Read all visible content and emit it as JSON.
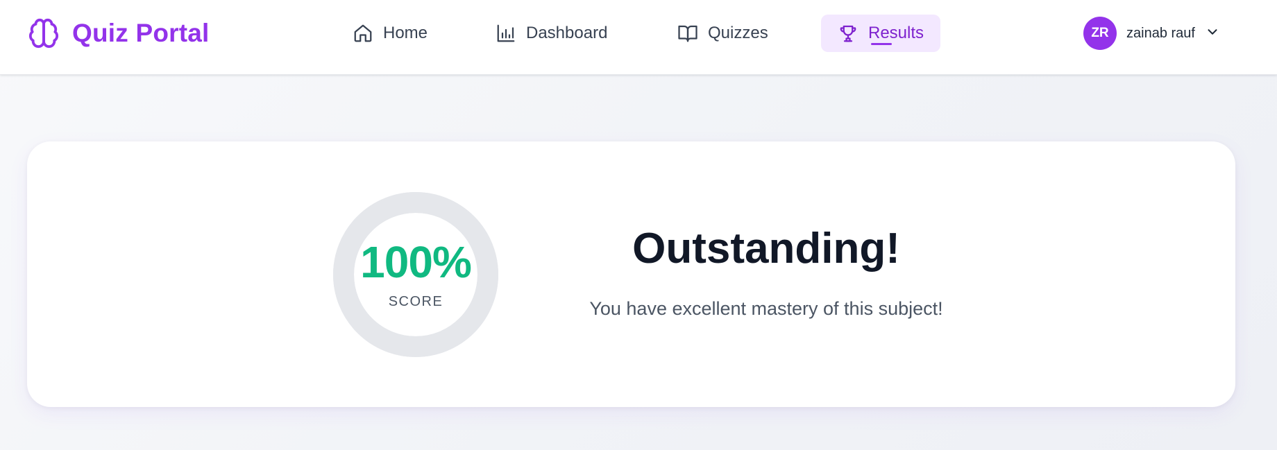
{
  "app": {
    "name": "Quiz Portal",
    "brand_color": "#9333ea",
    "logo_icon": "brain-icon"
  },
  "nav": {
    "items": [
      {
        "label": "Home",
        "icon": "home-icon",
        "active": false
      },
      {
        "label": "Dashboard",
        "icon": "bar-chart-icon",
        "active": false
      },
      {
        "label": "Quizzes",
        "icon": "book-icon",
        "active": false
      },
      {
        "label": "Results",
        "icon": "trophy-icon",
        "active": true
      }
    ],
    "active_bg": "#f3e8ff",
    "active_color": "#7e22ce"
  },
  "user": {
    "initials": "ZR",
    "name": "zainab rauf",
    "menu_icon": "chevron-down-icon"
  },
  "result": {
    "score": "100%",
    "score_fraction": 1.0,
    "score_label": "SCORE",
    "score_color": "#10b981",
    "ring_track_color": "#e5e7eb",
    "headline": "Outstanding!",
    "message": "You have excellent mastery of this subject!"
  }
}
